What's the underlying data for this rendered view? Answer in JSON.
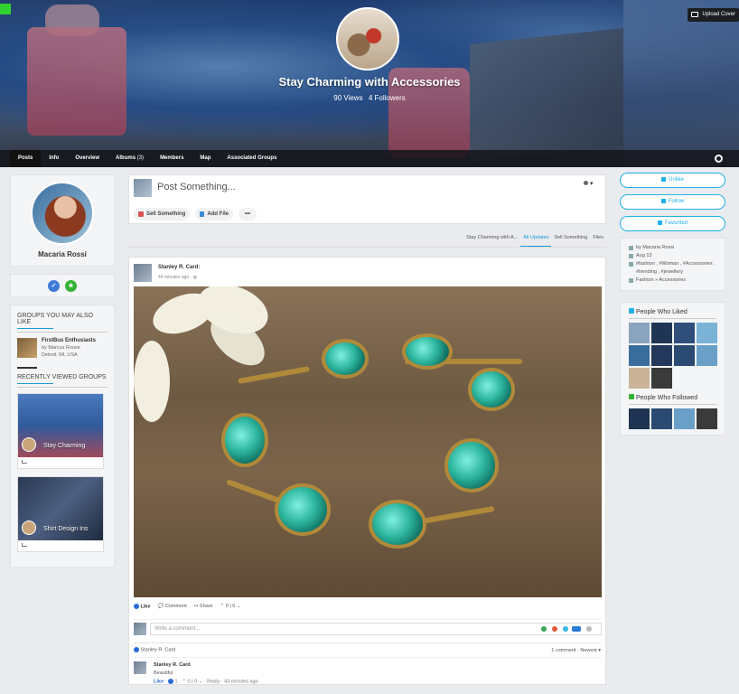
{
  "cover": {
    "upload_label": "Upload Cover",
    "title": "Stay Charming with Accessories",
    "views": "90 Views",
    "followers": "4 Followers"
  },
  "nav": {
    "tabs": [
      {
        "label": "Posts",
        "active": true
      },
      {
        "label": "Info"
      },
      {
        "label": "Overview"
      },
      {
        "label": "Albums",
        "count": "(3)"
      },
      {
        "label": "Members"
      },
      {
        "label": "Map"
      },
      {
        "label": "Associated Groups"
      }
    ]
  },
  "profile": {
    "name": "Macaria Rossi"
  },
  "left": {
    "groups_title": "GROUPS YOU MAY ALSO LIKE",
    "featured_group": {
      "name": "FirstBus Enthusiasts",
      "by": "by Marcus Rouse",
      "location": "Detroit, MI, USA"
    },
    "recent_title": "RECENTLY VIEWED GROUPS",
    "recent": [
      {
        "label": "Stay Charming"
      },
      {
        "label": "Shirt Design Ins"
      }
    ]
  },
  "composer": {
    "placeholder": "Post Something...",
    "sell_label": "Sell Something",
    "file_label": "Add File",
    "more_label": "•••"
  },
  "filters": [
    "Stay Charming with A...",
    "All Updates",
    "Sell Something",
    "Files"
  ],
  "post": {
    "author": "Stanley R. Card:",
    "time": "44 minutes ago · ",
    "like": "Like",
    "comment": "Comment",
    "share": "Share",
    "votes": "0 | 0",
    "comment_placeholder": "Write a comment...",
    "reaction_by": "Stanley R. Card",
    "comment_count": "1 comment",
    "sort": "Newest",
    "comment_item": {
      "author": "Stanley R. Card",
      "text": "Beautiful",
      "like": "Like",
      "likes": "1",
      "votes": "0 | 0",
      "reply": "Reply",
      "time": "43 minutes ago"
    }
  },
  "right": {
    "unlike": "Unlike",
    "follow": "Follow",
    "favorited": "Favorited",
    "by": "by Macaria Rossi",
    "date": "Aug 13",
    "tags": "#fashion , #Woman , #Accessories , #trending , #jewellery",
    "category": "Fashion » Accessories",
    "liked_title": "People Who Liked",
    "followed_title": "People Who Followed"
  },
  "colors": {
    "accent": "#1fb1e6",
    "nav_bg": "#141418"
  }
}
